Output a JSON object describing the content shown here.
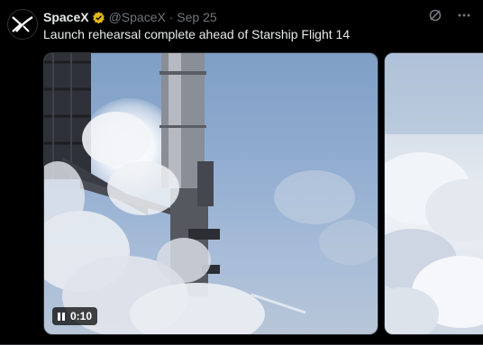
{
  "tweet": {
    "author_name": "SpaceX",
    "handle_and_time": "@SpaceX · Sep 25",
    "text": "Launch rehearsal complete ahead of Starship Flight 14",
    "verified_color": "#e2b719"
  },
  "media": {
    "video": {
      "duration": "0:10",
      "state": "pause-icon"
    },
    "second_image": {
      "description": "clouds"
    }
  },
  "icons": {
    "avatar": "spacex-logo-icon",
    "verified": "verified-badge-icon",
    "grok": "grok-icon",
    "more": "more-icon"
  }
}
